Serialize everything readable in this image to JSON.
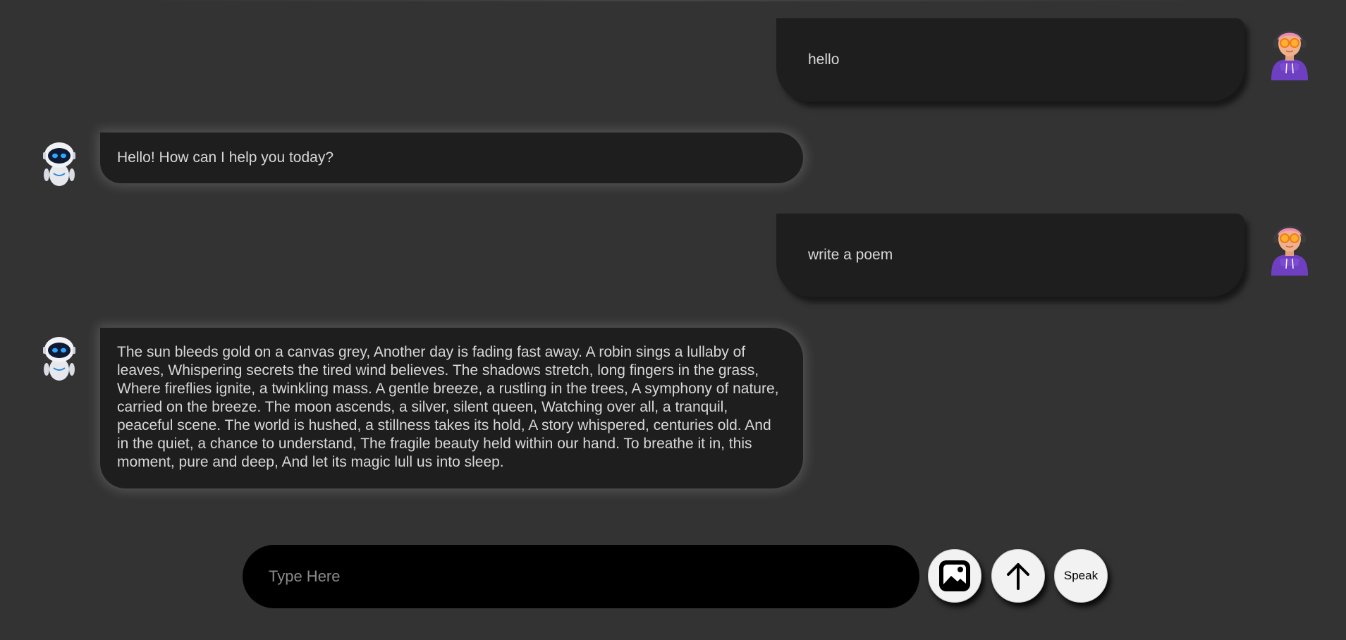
{
  "messages": [
    {
      "role": "user",
      "text": "hello"
    },
    {
      "role": "bot",
      "text": "Hello! How can I help you today?"
    },
    {
      "role": "user",
      "text": "write a poem"
    },
    {
      "role": "bot",
      "text": "The sun bleeds gold on a canvas grey, Another day is fading fast away. A robin sings a lullaby of leaves, Whispering secrets the tired wind believes. The shadows stretch, long fingers in the grass, Where fireflies ignite, a twinkling mass. A gentle breeze, a rustling in the trees, A symphony of nature, carried on the breeze. The moon ascends, a silver, silent queen, Watching over all, a tranquil, peaceful scene. The world is hushed, a stillness takes its hold, A story whispered, centuries old. And in the quiet, a chance to understand, The fragile beauty held within our hand. To breathe it in, this moment, pure and deep, And let its magic lull us into sleep."
    }
  ],
  "composer": {
    "placeholder": "Type Here",
    "value": ""
  },
  "buttons": {
    "image": {
      "icon": "image-icon"
    },
    "send": {
      "icon": "arrow-up-icon"
    },
    "speak": {
      "label": "Speak"
    }
  },
  "colors": {
    "background": "#333333",
    "bubble": "#1e1e1e",
    "bubble_text": "#d8d8d8",
    "composer": "#000000",
    "button": "#f2f2f2"
  }
}
